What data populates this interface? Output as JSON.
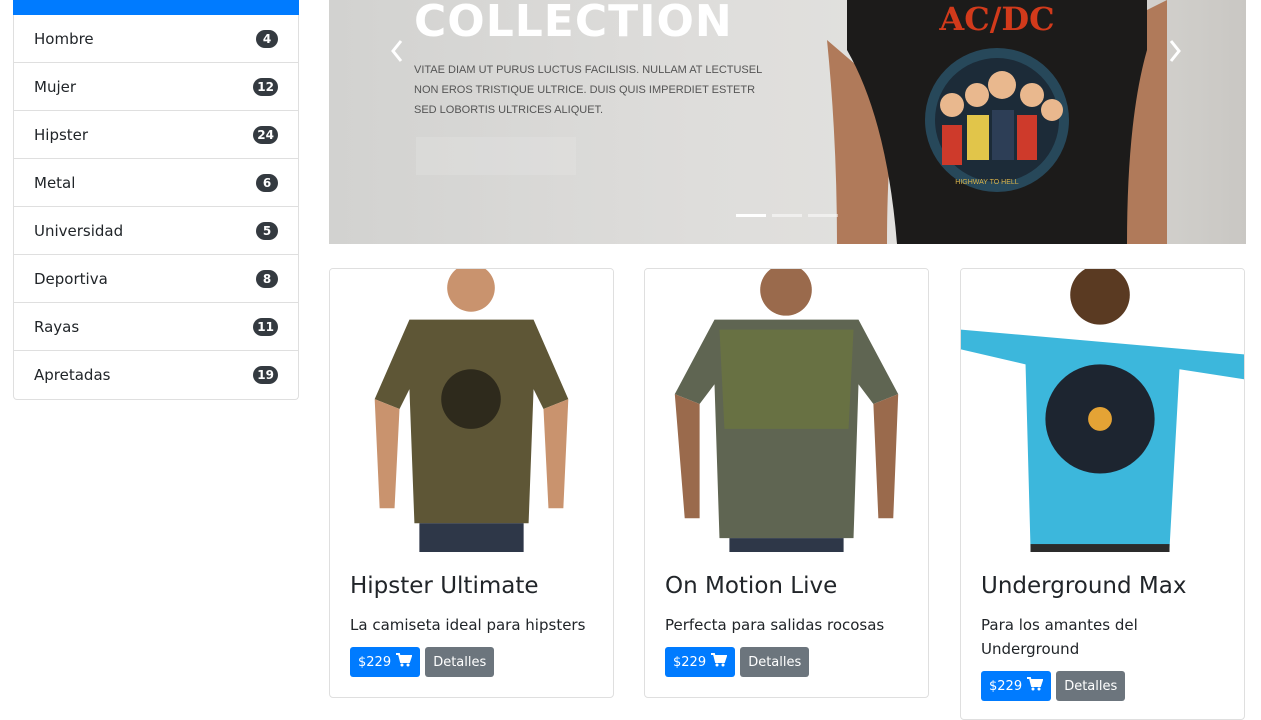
{
  "sidebar": {
    "items": [
      {
        "label": "Hombre",
        "count": "4"
      },
      {
        "label": "Mujer",
        "count": "12"
      },
      {
        "label": "Hipster",
        "count": "24"
      },
      {
        "label": "Metal",
        "count": "6"
      },
      {
        "label": "Universidad",
        "count": "5"
      },
      {
        "label": "Deportiva",
        "count": "8"
      },
      {
        "label": "Rayas",
        "count": "11"
      },
      {
        "label": "Apretadas",
        "count": "19"
      }
    ]
  },
  "carousel": {
    "title": "COLLECTION",
    "text": "VITAE DIAM UT PURUS LUCTUS FACILISIS. NULLAM AT LECTUSEL NON EROS TRISTIQUE ULTRICE. DUIS QUIS IMPERDIET ESTETR SED LOBORTIS ULTRICES ALIQUET.",
    "shirt_print": "AC/DC",
    "shirt_subtext": "HIGHWAY TO HELL",
    "active_slide": 1,
    "slide_count": 3
  },
  "products": [
    {
      "title": "Hipster Ultimate",
      "description": "La camiseta ideal para hipsters",
      "price": "$229",
      "details_label": "Detalles",
      "shirt_color": "#5e5636"
    },
    {
      "title": "On Motion Live",
      "description": "Perfecta para salidas rocosas",
      "price": "$229",
      "details_label": "Detalles",
      "shirt_color": "#5f6552"
    },
    {
      "title": "Underground Max",
      "description": "Para los amantes del Underground",
      "price": "$229",
      "details_label": "Detalles",
      "shirt_color": "#3cb7dc"
    }
  ],
  "colors": {
    "primary": "#007bff",
    "secondary": "#6c757d",
    "badge": "#343a40"
  }
}
